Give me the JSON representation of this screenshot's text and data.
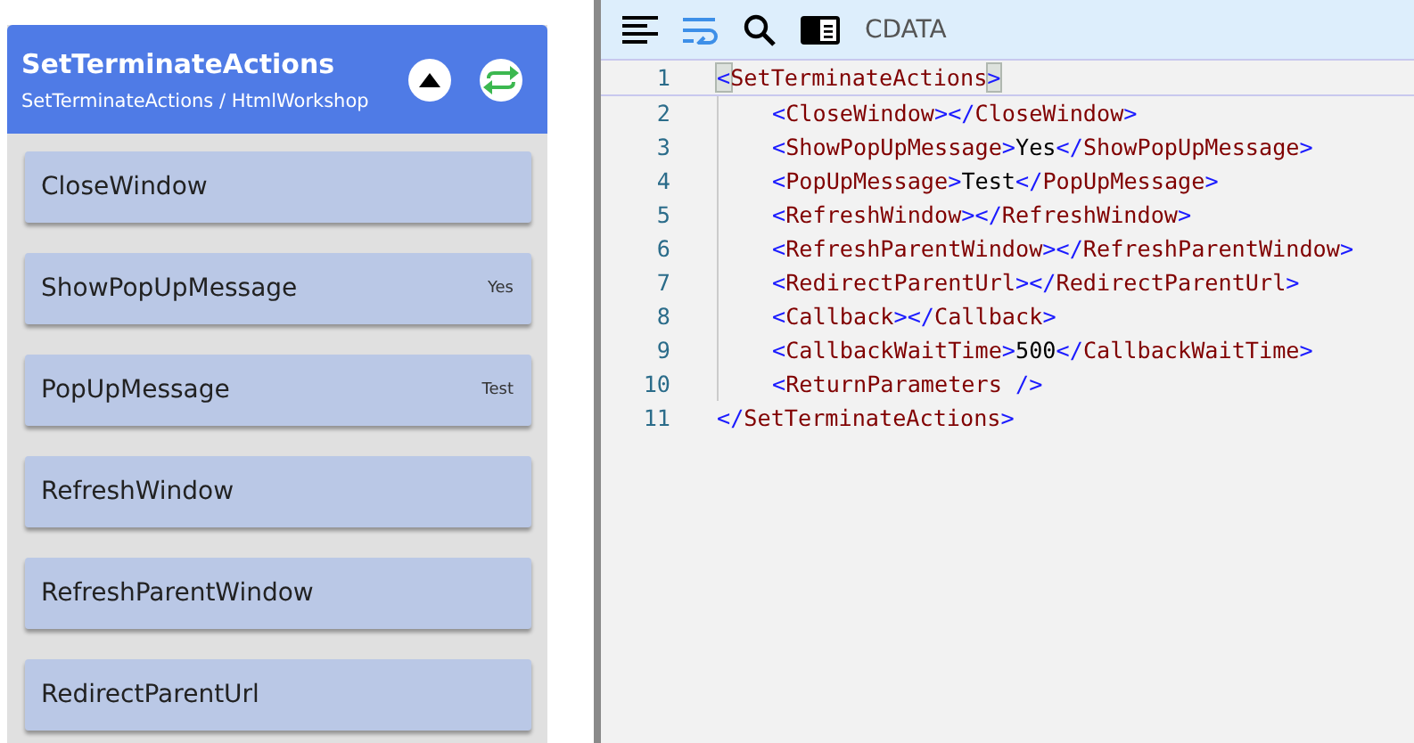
{
  "panel": {
    "title": "SetTerminateActions",
    "breadcrumb": "SetTerminateActions / HtmlWorkshop"
  },
  "items": [
    {
      "name": "CloseWindow"
    },
    {
      "name": "ShowPopUpMessage",
      "value": "Yes"
    },
    {
      "name": "PopUpMessage",
      "value": "Test"
    },
    {
      "name": "RefreshWindow"
    },
    {
      "name": "RefreshParentWindow"
    },
    {
      "name": "RedirectParentUrl"
    }
  ],
  "toolbar": {
    "cdata_label": "CDATA",
    "wrap_on": true
  },
  "code_lines": [
    {
      "number": "1",
      "tokens": [
        {
          "kind": "match",
          "text": "<"
        },
        {
          "kind": "tag",
          "text": "SetTerminateActions"
        },
        {
          "kind": "match",
          "text": ">"
        }
      ],
      "children": [
        {
          "number": "2",
          "tokens": [
            {
              "kind": "punct",
              "text": "<"
            },
            {
              "kind": "tag",
              "text": "CloseWindow"
            },
            {
              "kind": "punct",
              "text": "></"
            },
            {
              "kind": "tag",
              "text": "CloseWindow"
            },
            {
              "kind": "punct",
              "text": ">"
            }
          ]
        },
        {
          "number": "3",
          "tokens": [
            {
              "kind": "punct",
              "text": "<"
            },
            {
              "kind": "tag",
              "text": "ShowPopUpMessage"
            },
            {
              "kind": "punct",
              "text": ">"
            },
            {
              "kind": "text",
              "text": "Yes"
            },
            {
              "kind": "punct",
              "text": "</"
            },
            {
              "kind": "tag",
              "text": "ShowPopUpMessage"
            },
            {
              "kind": "punct",
              "text": ">"
            }
          ]
        },
        {
          "number": "4",
          "tokens": [
            {
              "kind": "punct",
              "text": "<"
            },
            {
              "kind": "tag",
              "text": "PopUpMessage"
            },
            {
              "kind": "punct",
              "text": ">"
            },
            {
              "kind": "text",
              "text": "Test"
            },
            {
              "kind": "punct",
              "text": "</"
            },
            {
              "kind": "tag",
              "text": "PopUpMessage"
            },
            {
              "kind": "punct",
              "text": ">"
            }
          ]
        },
        {
          "number": "5",
          "tokens": [
            {
              "kind": "punct",
              "text": "<"
            },
            {
              "kind": "tag",
              "text": "RefreshWindow"
            },
            {
              "kind": "punct",
              "text": "></"
            },
            {
              "kind": "tag",
              "text": "RefreshWindow"
            },
            {
              "kind": "punct",
              "text": ">"
            }
          ]
        },
        {
          "number": "6",
          "tokens": [
            {
              "kind": "punct",
              "text": "<"
            },
            {
              "kind": "tag",
              "text": "RefreshParentWindow"
            },
            {
              "kind": "punct",
              "text": "></"
            },
            {
              "kind": "tag",
              "text": "RefreshParentWindow"
            },
            {
              "kind": "punct",
              "text": ">"
            }
          ]
        },
        {
          "number": "7",
          "tokens": [
            {
              "kind": "punct",
              "text": "<"
            },
            {
              "kind": "tag",
              "text": "RedirectParentUrl"
            },
            {
              "kind": "punct",
              "text": "></"
            },
            {
              "kind": "tag",
              "text": "RedirectParentUrl"
            },
            {
              "kind": "punct",
              "text": ">"
            }
          ]
        },
        {
          "number": "8",
          "tokens": [
            {
              "kind": "punct",
              "text": "<"
            },
            {
              "kind": "tag",
              "text": "Callback"
            },
            {
              "kind": "punct",
              "text": "></"
            },
            {
              "kind": "tag",
              "text": "Callback"
            },
            {
              "kind": "punct",
              "text": ">"
            }
          ]
        },
        {
          "number": "9",
          "tokens": [
            {
              "kind": "punct",
              "text": "<"
            },
            {
              "kind": "tag",
              "text": "CallbackWaitTime"
            },
            {
              "kind": "punct",
              "text": ">"
            },
            {
              "kind": "text",
              "text": "500"
            },
            {
              "kind": "punct",
              "text": "</"
            },
            {
              "kind": "tag",
              "text": "CallbackWaitTime"
            },
            {
              "kind": "punct",
              "text": ">"
            }
          ]
        },
        {
          "number": "10",
          "tokens": [
            {
              "kind": "punct",
              "text": "<"
            },
            {
              "kind": "tag",
              "text": "ReturnParameters "
            },
            {
              "kind": "punct",
              "text": "/>"
            }
          ]
        }
      ]
    },
    {
      "number": "11",
      "tokens": [
        {
          "kind": "punct",
          "text": "</"
        },
        {
          "kind": "tag",
          "text": "SetTerminateActions"
        },
        {
          "kind": "punct",
          "text": ">"
        }
      ]
    }
  ]
}
